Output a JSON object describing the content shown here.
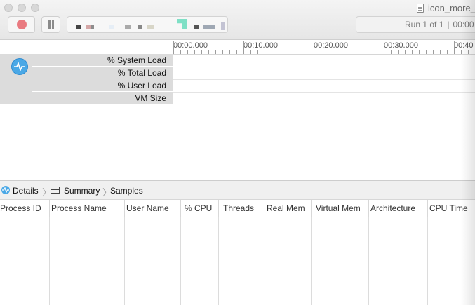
{
  "window": {
    "title": "icon_more_"
  },
  "toolbar": {
    "record_icon": "record-dot",
    "pause_icon": "pause-bars",
    "target_chip_colors": [
      "#444444",
      "#d4a6a6",
      "#8d8d8d",
      "#e6eef6",
      "#aaaaaa",
      "#888888",
      "#d8d6c8",
      "#7fe0c6",
      "#555555",
      "#9fa8b4",
      "#c3c3d3"
    ],
    "run_label": "Run 1 of 1",
    "run_separator": "|",
    "run_time": "00:00"
  },
  "timeline": {
    "ruler_ticks": [
      "00:00.000",
      "00:10.000",
      "00:20.000",
      "00:30.000",
      "00:40"
    ],
    "instrument_icon": "activity-monitor-icon",
    "tracks": [
      "% System Load",
      "% Total Load",
      "% User Load",
      "VM Size"
    ]
  },
  "detail": {
    "breadcrumbs": [
      "Details",
      "Summary",
      "Samples"
    ],
    "columns": [
      "Process ID",
      "Process Name",
      "User Name",
      "% CPU",
      "Threads",
      "Real Mem",
      "Virtual Mem",
      "Architecture",
      "CPU Time"
    ],
    "rows": []
  },
  "colors": {
    "accent": "#4aa8e6",
    "record": "#e97a80",
    "sidebar": "#dcdcdc"
  }
}
